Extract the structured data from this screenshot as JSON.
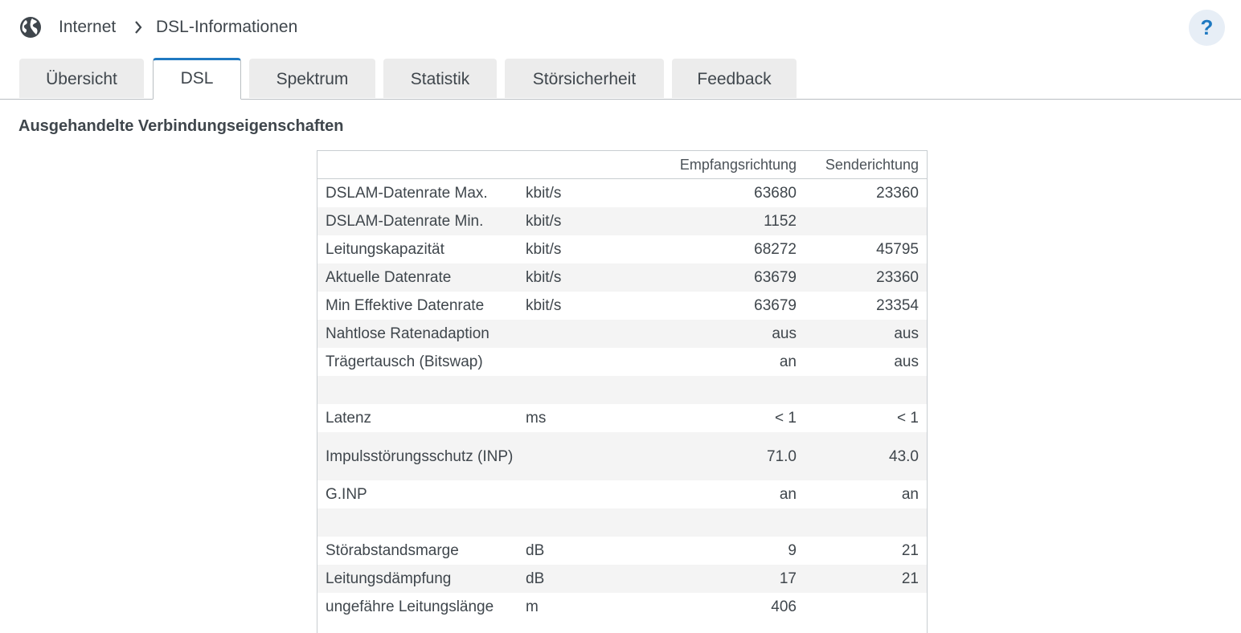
{
  "breadcrumb": {
    "root": "Internet",
    "current": "DSL-Informationen"
  },
  "help": {
    "label": "?"
  },
  "tabs": [
    {
      "label": "Übersicht",
      "active": false
    },
    {
      "label": "DSL",
      "active": true
    },
    {
      "label": "Spektrum",
      "active": false
    },
    {
      "label": "Statistik",
      "active": false
    },
    {
      "label": "Störsicherheit",
      "active": false
    },
    {
      "label": "Feedback",
      "active": false
    }
  ],
  "section": {
    "title": "Ausgehandelte Verbindungseigenschaften"
  },
  "table": {
    "headers": {
      "label": "",
      "unit": "",
      "down": "Empfangsrichtung",
      "up": "Senderichtung"
    },
    "rows": [
      {
        "label": "DSLAM-Datenrate Max.",
        "unit": "kbit/s",
        "down": "63680",
        "up": "23360"
      },
      {
        "label": "DSLAM-Datenrate Min.",
        "unit": "kbit/s",
        "down": "1152",
        "up": ""
      },
      {
        "label": "Leitungskapazität",
        "unit": "kbit/s",
        "down": "68272",
        "up": "45795"
      },
      {
        "label": "Aktuelle Datenrate",
        "unit": "kbit/s",
        "down": "63679",
        "up": "23360"
      },
      {
        "label": "Min Effektive Datenrate",
        "unit": "kbit/s",
        "down": "63679",
        "up": "23354"
      },
      {
        "label": "Nahtlose Ratenadaption",
        "unit": "",
        "down": "aus",
        "up": "aus"
      },
      {
        "label": "Trägertausch (Bitswap)",
        "unit": "",
        "down": "an",
        "up": "aus"
      },
      {
        "label": "",
        "unit": "",
        "down": "",
        "up": ""
      },
      {
        "label": "Latenz",
        "unit": "ms",
        "down": "< 1",
        "up": "< 1"
      },
      {
        "label": "Impulsstörungsschutz (INP)",
        "unit": "",
        "down": "71.0",
        "up": "43.0"
      },
      {
        "label": "G.INP",
        "unit": "",
        "down": "an",
        "up": "an"
      },
      {
        "label": "",
        "unit": "",
        "down": "",
        "up": ""
      },
      {
        "label": "Störabstandsmarge",
        "unit": "dB",
        "down": "9",
        "up": "21"
      },
      {
        "label": "Leitungsdämpfung",
        "unit": "dB",
        "down": "17",
        "up": "21"
      },
      {
        "label": "ungefähre Leitungslänge",
        "unit": "m",
        "down": "406",
        "up": ""
      }
    ]
  },
  "colors": {
    "accent": "#1f79c1",
    "text": "#3f464c",
    "tab_bg": "#ececec",
    "row_alt": "#f4f4f4"
  }
}
